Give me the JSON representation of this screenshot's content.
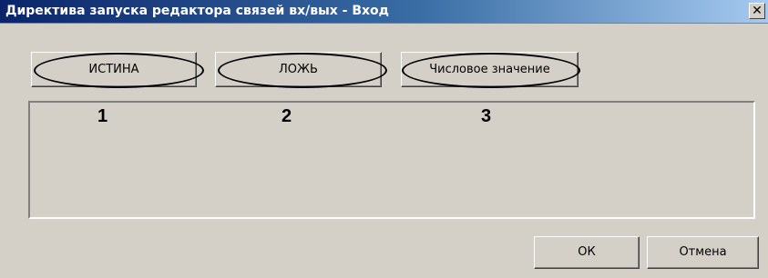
{
  "window": {
    "title": "Директива запуска редактора связей вх/вых - Вход",
    "close_glyph": "✕"
  },
  "top_buttons": [
    {
      "label": "ИСТИНА"
    },
    {
      "label": "ЛОЖЬ"
    },
    {
      "label": "Числовое значение"
    }
  ],
  "annotations": {
    "n1": "1",
    "n2": "2",
    "n3": "3"
  },
  "footer": {
    "ok_label": "ОК",
    "cancel_label": "Отмена"
  }
}
